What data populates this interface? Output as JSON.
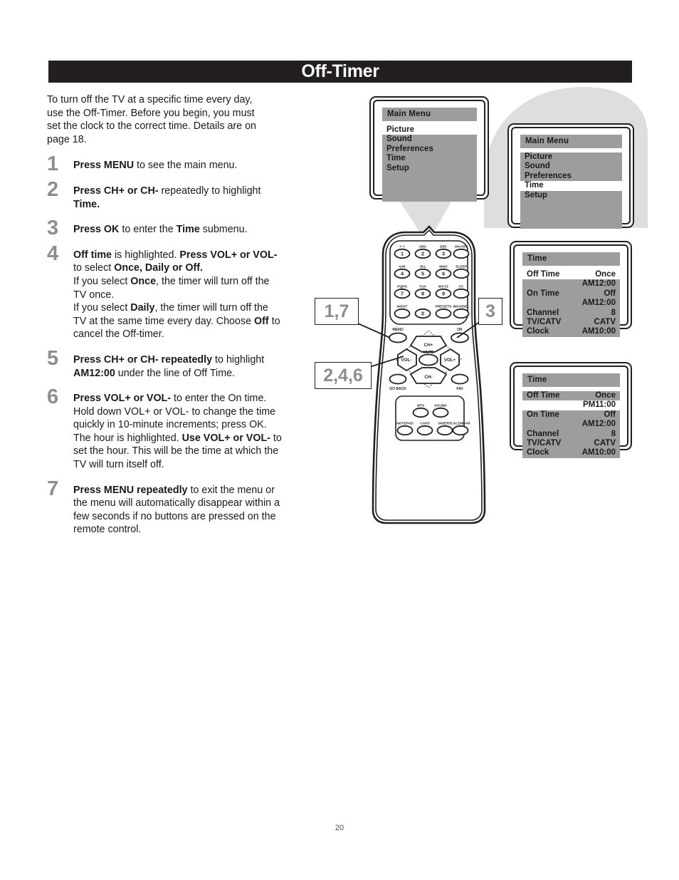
{
  "page": {
    "title": "Off-Timer",
    "number": "20"
  },
  "intro": "To turn off the TV at a specific time every day, use the Off-Timer. Before you begin, you must set the clock to the correct time. Details are on page 18.",
  "steps": [
    {
      "num": "1",
      "html": "<b>Press MENU</b> to see the main menu."
    },
    {
      "num": "2",
      "html": "<b>Press CH+ or CH-</b> repeatedly to highlight <b>Time.</b>"
    },
    {
      "num": "3",
      "html": "<b>Press OK</b> to enter the <b>Time</b> submenu."
    },
    {
      "num": "4",
      "html": "<b>Off time</b> is highlighted. <b>Press VOL+ or VOL-</b> to select <b>Once, Daily or Off.</b><br>If you select <b>Once</b>, the timer will turn off the TV once.<br>If you select <b>Daily</b>, the timer will turn off the TV at the same time every day. Choose <b>Off</b> to cancel the Off-timer."
    },
    {
      "num": "5",
      "html": "<b>Press CH+ or CH- repeatedly</b> to highlight <b>AM12:00</b> under the line of Off Time."
    },
    {
      "num": "6",
      "html": "<b>Press VOL+ or VOL-</b> to enter the On time. Hold down VOL+ or VOL- to change the time quickly in 10-minute increments; press OK. The hour is highlighted. <b>Use VOL+ or VOL-</b> to set the hour. This will be the time at which the TV will turn itself off."
    },
    {
      "num": "7",
      "html": "<b>Press MENU repeatedly</b> to exit the menu or the menu will automatically disappear within a few seconds if no buttons are pressed on the remote control."
    }
  ],
  "screens": [
    {
      "id": "main-menu-picture",
      "title": "Main Menu",
      "rows": [
        {
          "label": "Picture",
          "value": "",
          "highlighted": true
        },
        {
          "label": "Sound",
          "value": "",
          "highlighted": false
        },
        {
          "label": "Preferences",
          "value": "",
          "highlighted": false
        },
        {
          "label": "Time",
          "value": "",
          "highlighted": false
        },
        {
          "label": "Setup",
          "value": "",
          "highlighted": false
        }
      ]
    },
    {
      "id": "main-menu-time",
      "title": "Main Menu",
      "rows": [
        {
          "label": "Picture",
          "value": "",
          "highlighted": false
        },
        {
          "label": "Sound",
          "value": "",
          "highlighted": false
        },
        {
          "label": "Preferences",
          "value": "",
          "highlighted": false
        },
        {
          "label": "Time",
          "value": "",
          "highlighted": true
        },
        {
          "label": "Setup",
          "value": "",
          "highlighted": false
        }
      ]
    },
    {
      "id": "time-menu-offtime",
      "title": "Time",
      "rows": [
        {
          "label": "Off Time",
          "value": "Once",
          "highlighted": true
        },
        {
          "label": "",
          "value": "AM12:00",
          "highlighted": false
        },
        {
          "label": "On Time",
          "value": "Off",
          "highlighted": false
        },
        {
          "label": "",
          "value": "AM12:00",
          "highlighted": false
        },
        {
          "label": "Channel",
          "value": "8",
          "highlighted": false
        },
        {
          "label": "TV/CATV",
          "value": "CATV",
          "highlighted": false
        },
        {
          "label": "Clock",
          "value": "AM10:00",
          "highlighted": false
        }
      ]
    },
    {
      "id": "time-menu-pm11",
      "title": "Time",
      "rows": [
        {
          "label": "Off Time",
          "value": "Once",
          "highlighted": false
        },
        {
          "label": "",
          "value": "PM11:00",
          "highlighted": true
        },
        {
          "label": "On Time",
          "value": "Off",
          "highlighted": false
        },
        {
          "label": "",
          "value": "AM12:00",
          "highlighted": false
        },
        {
          "label": "Channel",
          "value": "8",
          "highlighted": false
        },
        {
          "label": "TV/CATV",
          "value": "CATV",
          "highlighted": false
        },
        {
          "label": "Clock",
          "value": "AM10:00",
          "highlighted": false
        }
      ]
    }
  ],
  "callouts": [
    {
      "id": "callout-menu",
      "label": "1,7"
    },
    {
      "id": "callout-ok",
      "label": "3"
    },
    {
      "id": "callout-vol",
      "label": "2,4,6"
    }
  ],
  "remote": {
    "keypad": [
      {
        "top": "+-?",
        "main": "1"
      },
      {
        "top": "ABC",
        "main": "2"
      },
      {
        "top": "DEF",
        "main": "3"
      },
      {
        "top": "ON-OFF",
        "main": ""
      },
      {
        "top": "GHI",
        "main": "4"
      },
      {
        "top": "JKL",
        "main": "5"
      },
      {
        "top": "MNO",
        "main": "6"
      },
      {
        "top": "SLEEP",
        "main": ""
      },
      {
        "top": "PQRS",
        "main": "7"
      },
      {
        "top": "TUV",
        "main": "8"
      },
      {
        "top": "WXYZ",
        "main": "9"
      },
      {
        "top": "CC",
        "main": ""
      },
      {
        "top": "INPUT",
        "main": ""
      },
      {
        "top": "",
        "main": "0"
      },
      {
        "top": "PRESETS",
        "main": ""
      },
      {
        "top": "INFO/DEL",
        "main": ""
      }
    ],
    "nav": {
      "menu": "MENU",
      "ok": "OK",
      "ch_up": "CH+",
      "ch_down": "CH-",
      "vol_down": "VOL-",
      "vol_up": "VOL+",
      "mute": "MUTE",
      "go_back": "GO BACK",
      "fav": "FAV"
    },
    "bottom": [
      "MTS",
      "SOUND",
      "NOTEPAD",
      "CAPS",
      "INSERT",
      "CALENDAR"
    ]
  },
  "colors": {
    "header_bg": "#231f20",
    "osd_gray": "#9d9d9d",
    "step_num": "#8e8e8e",
    "swoosh": "#dcdcdc"
  }
}
